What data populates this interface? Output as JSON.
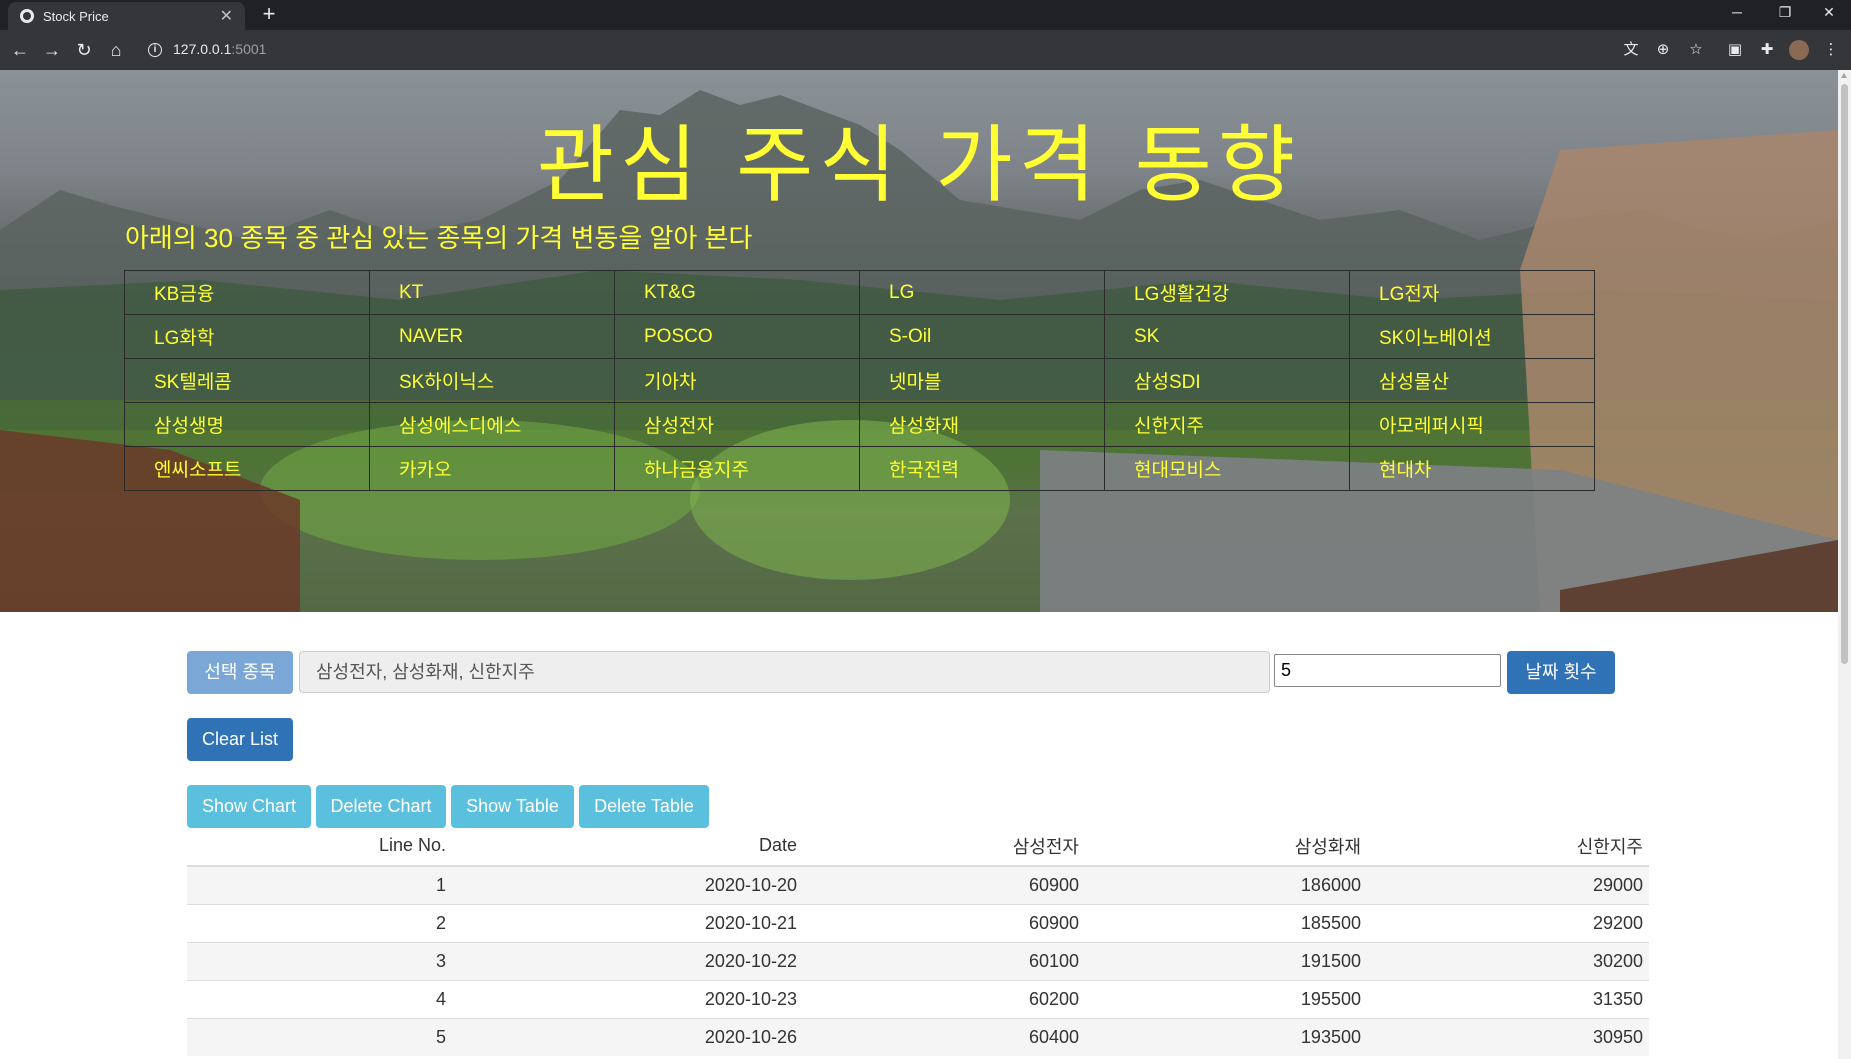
{
  "browser": {
    "tab_title": "Stock Price",
    "url_host": "127.0.0.1",
    "url_port": ":5001"
  },
  "hero": {
    "title": "관심 주식 가격 동향",
    "subtitle": "아래의 30 종목 중 관심 있는 종목의 가격 변동을 알아 본다",
    "stocks": [
      [
        "KB금융",
        "KT",
        "KT&G",
        "LG",
        "LG생활건강",
        "LG전자"
      ],
      [
        "LG화학",
        "NAVER",
        "POSCO",
        "S-Oil",
        "SK",
        "SK이노베이션"
      ],
      [
        "SK텔레콤",
        "SK하이닉스",
        "기아차",
        "넷마블",
        "삼성SDI",
        "삼성물산"
      ],
      [
        "삼성생명",
        "삼성에스디에스",
        "삼성전자",
        "삼성화재",
        "신한지주",
        "아모레퍼시픽"
      ],
      [
        "엔씨소프트",
        "카카오",
        "하나금융지주",
        "한국전력",
        "현대모비스",
        "현대차"
      ]
    ]
  },
  "controls": {
    "select_label": "선택 종목",
    "selected_value": "삼성전자, 삼성화재, 신한지주",
    "count_value": "5",
    "count_button": "날짜 횟수",
    "clear_button": "Clear List",
    "show_chart": "Show Chart",
    "delete_chart": "Delete Chart",
    "show_table": "Show Table",
    "delete_table": "Delete Table"
  },
  "table": {
    "headers": [
      "Line No.",
      "Date",
      "삼성전자",
      "삼성화재",
      "신한지주"
    ],
    "rows": [
      [
        "1",
        "2020-10-20",
        "60900",
        "186000",
        "29000"
      ],
      [
        "2",
        "2020-10-21",
        "60900",
        "185500",
        "29200"
      ],
      [
        "3",
        "2020-10-22",
        "60100",
        "191500",
        "30200"
      ],
      [
        "4",
        "2020-10-23",
        "60200",
        "195500",
        "31350"
      ],
      [
        "5",
        "2020-10-26",
        "60400",
        "193500",
        "30950"
      ]
    ]
  },
  "colors": {
    "hero_text": "#ffff33",
    "primary": "#2f73b6",
    "info": "#5bc0de"
  }
}
